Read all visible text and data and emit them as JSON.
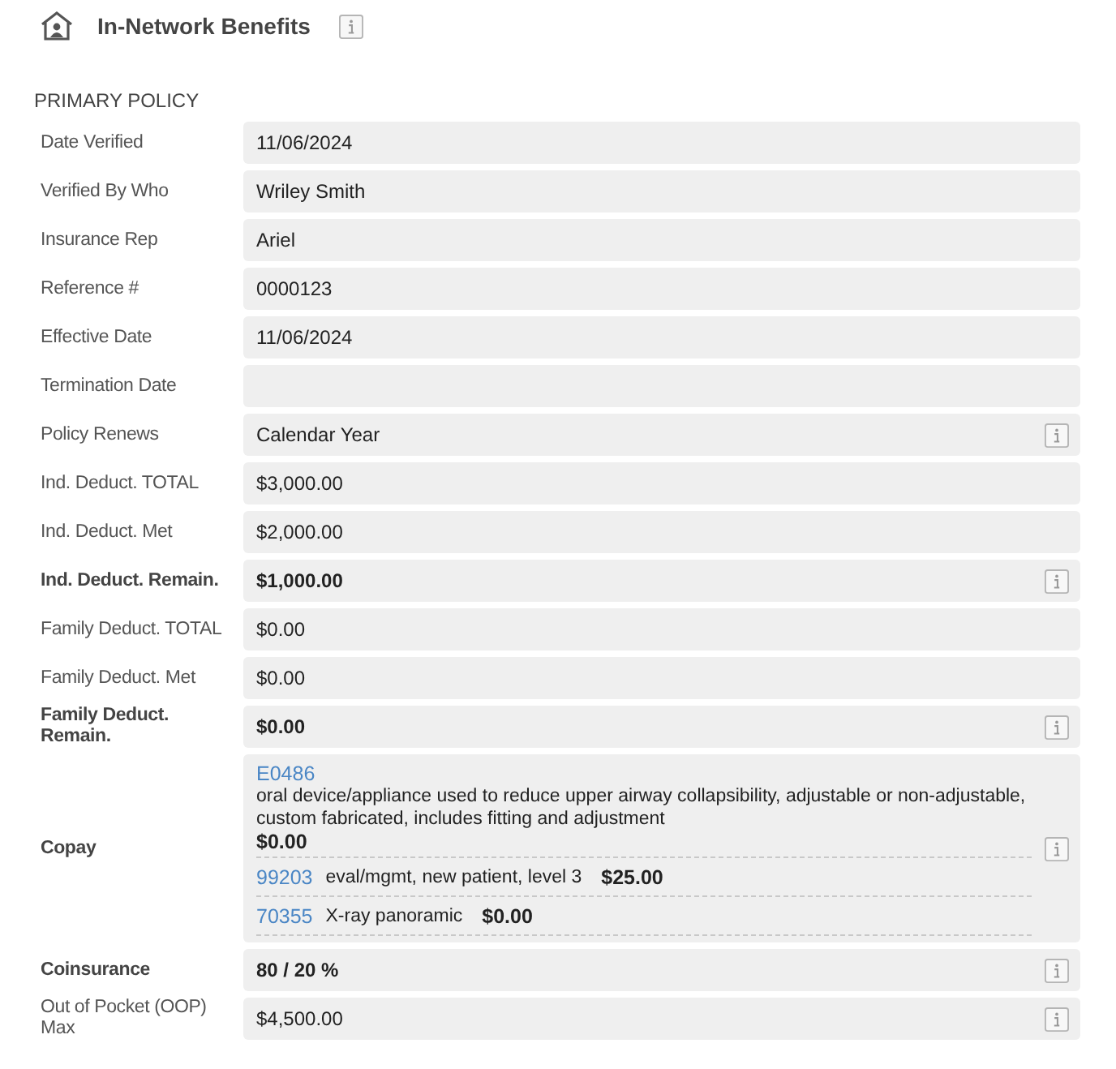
{
  "header": {
    "title": "In-Network Benefits",
    "info": true
  },
  "section": "PRIMARY POLICY",
  "rows": [
    {
      "kind": "field",
      "label": "Date Verified",
      "value": "11/06/2024",
      "bold": false,
      "info": false
    },
    {
      "kind": "field",
      "label": "Verified By Who",
      "value": "Wriley Smith",
      "bold": false,
      "info": false
    },
    {
      "kind": "field",
      "label": "Insurance Rep",
      "value": "Ariel",
      "bold": false,
      "info": false
    },
    {
      "kind": "field",
      "label": "Reference #",
      "value": "0000123",
      "bold": false,
      "info": false
    },
    {
      "kind": "field",
      "label": "Effective Date",
      "value": "11/06/2024",
      "bold": false,
      "info": false
    },
    {
      "kind": "field",
      "label": "Termination Date",
      "bold": false,
      "info": false
    },
    {
      "kind": "field",
      "label": "Policy Renews",
      "value": "Calendar Year",
      "bold": false,
      "info": true
    },
    {
      "kind": "field",
      "label": "Ind. Deduct. TOTAL",
      "value": "$3,000.00",
      "bold": false,
      "info": false
    },
    {
      "kind": "field",
      "label": "Ind. Deduct. Met",
      "value": "$2,000.00",
      "bold": false,
      "info": false
    },
    {
      "kind": "field",
      "label": "Ind. Deduct. Remain.",
      "value": "$1,000.00",
      "bold": true,
      "info": true
    },
    {
      "kind": "field",
      "label": "Family Deduct. TOTAL",
      "value": "$0.00",
      "bold": false,
      "info": false
    },
    {
      "kind": "field",
      "label": "Family Deduct. Met",
      "value": "$0.00",
      "bold": false,
      "info": false
    },
    {
      "kind": "field",
      "label": "Family Deduct. Remain.",
      "value": "$0.00",
      "bold": true,
      "info": true
    },
    {
      "kind": "codes",
      "label": "Copay",
      "bold": true,
      "info": true,
      "items": [
        {
          "kind": "block",
          "code": "E0486",
          "description": "oral device/appliance used to reduce upper airway collapsibility, adjustable or non-adjustable, custom fabricated, includes fitting and adjustment",
          "amount": "$0.00"
        },
        {
          "kind": "inline",
          "code": "99203",
          "description": "eval/mgmt, new patient, level 3",
          "amount": "$25.00"
        },
        {
          "kind": "inline",
          "code": "70355",
          "description": "X-ray panoramic",
          "amount": "$0.00"
        }
      ]
    },
    {
      "kind": "field",
      "label": "Coinsurance",
      "value": "80 / 20 %",
      "bold": true,
      "info": true
    },
    {
      "kind": "field",
      "label": "Out of Pocket (OOP) Max",
      "value": "$4,500.00",
      "bold": false,
      "info": true
    }
  ]
}
